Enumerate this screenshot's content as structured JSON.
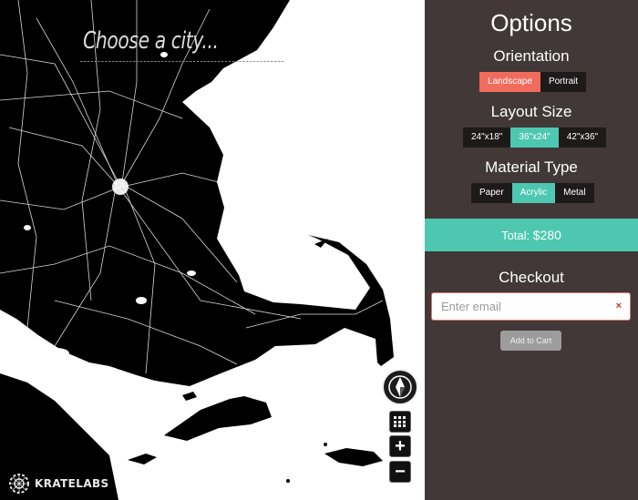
{
  "map": {
    "city_placeholder": "Choose a city...",
    "brand_name": "KRATELABS",
    "controls": {
      "compass_icon": "compass-icon",
      "grid_icon": "grid-icon",
      "zoom_in_label": "+",
      "zoom_out_label": "−"
    }
  },
  "options": {
    "title": "Options",
    "orientation": {
      "heading": "Orientation",
      "buttons": [
        "Landscape",
        "Portrait"
      ],
      "selected": "Landscape"
    },
    "layout_size": {
      "heading": "Layout Size",
      "buttons": [
        "24\"x18\"",
        "36\"x24\"",
        "42\"x36\""
      ],
      "selected": "36\"x24\""
    },
    "material": {
      "heading": "Material Type",
      "buttons": [
        "Paper",
        "Acrylic",
        "Metal"
      ],
      "selected": "Acrylic"
    },
    "total": {
      "label": "Total:",
      "amount": "$280"
    },
    "checkout": {
      "heading": "Checkout",
      "email_placeholder": "Enter email",
      "clear_icon": "×",
      "add_to_cart": "Add to Cart"
    }
  },
  "colors": {
    "panel_bg": "#413837",
    "accent_red": "#f26c5e",
    "accent_teal": "#4ec7b1",
    "map_land": "#000000",
    "map_water": "#ffffff"
  }
}
